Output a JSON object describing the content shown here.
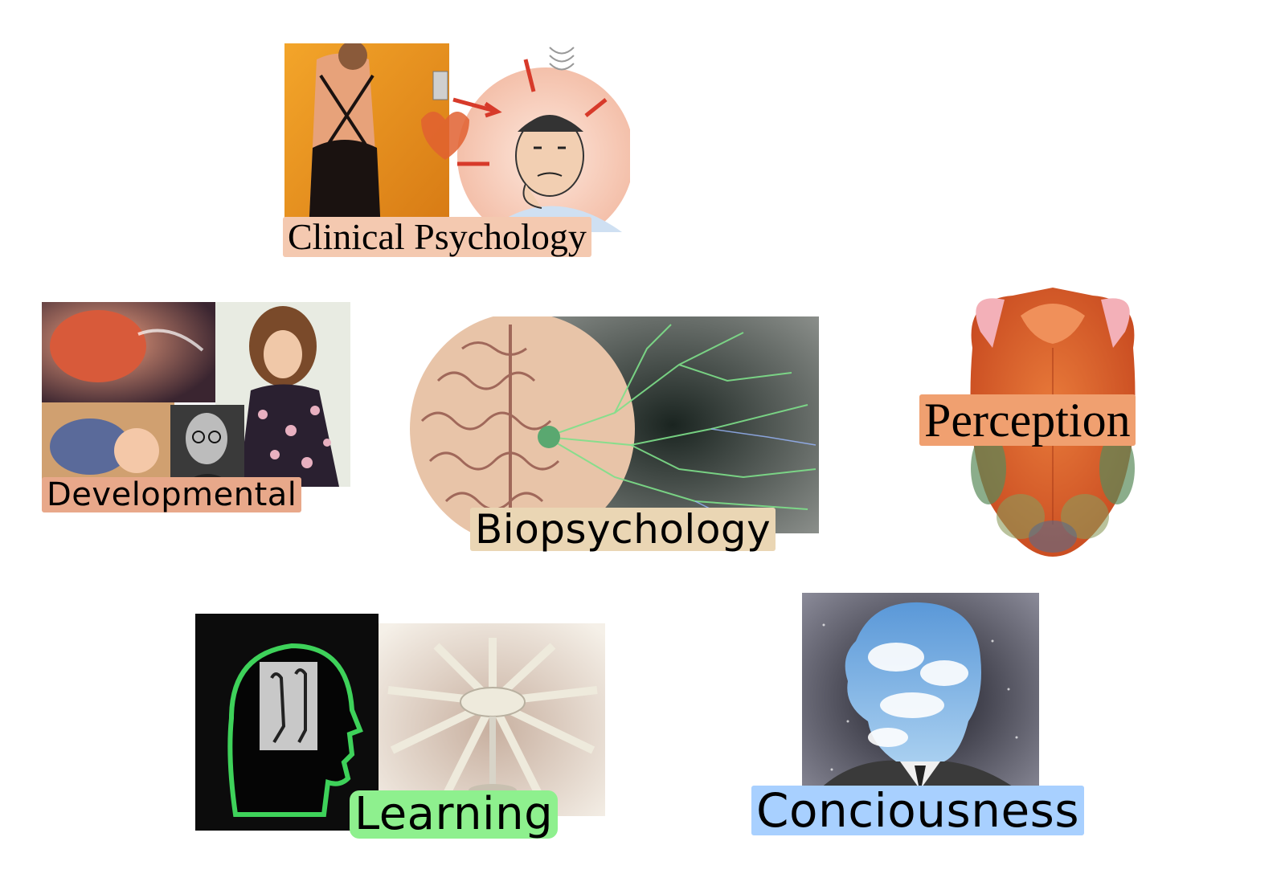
{
  "topics": {
    "clinical": {
      "label": "Clinical Psychology",
      "highlight": "#f4c9b0"
    },
    "developmental": {
      "label": "Developmental",
      "highlight": "#e8a88a"
    },
    "biopsychology": {
      "label": "Biopsychology",
      "highlight": "#ead6b4"
    },
    "perception": {
      "label": "Perception",
      "highlight": "#f0a070"
    },
    "learning": {
      "label": "Learning",
      "highlight": "#8ef08e"
    },
    "consciousness": {
      "label": "Conciousness",
      "highlight": "#a8d0ff"
    }
  }
}
